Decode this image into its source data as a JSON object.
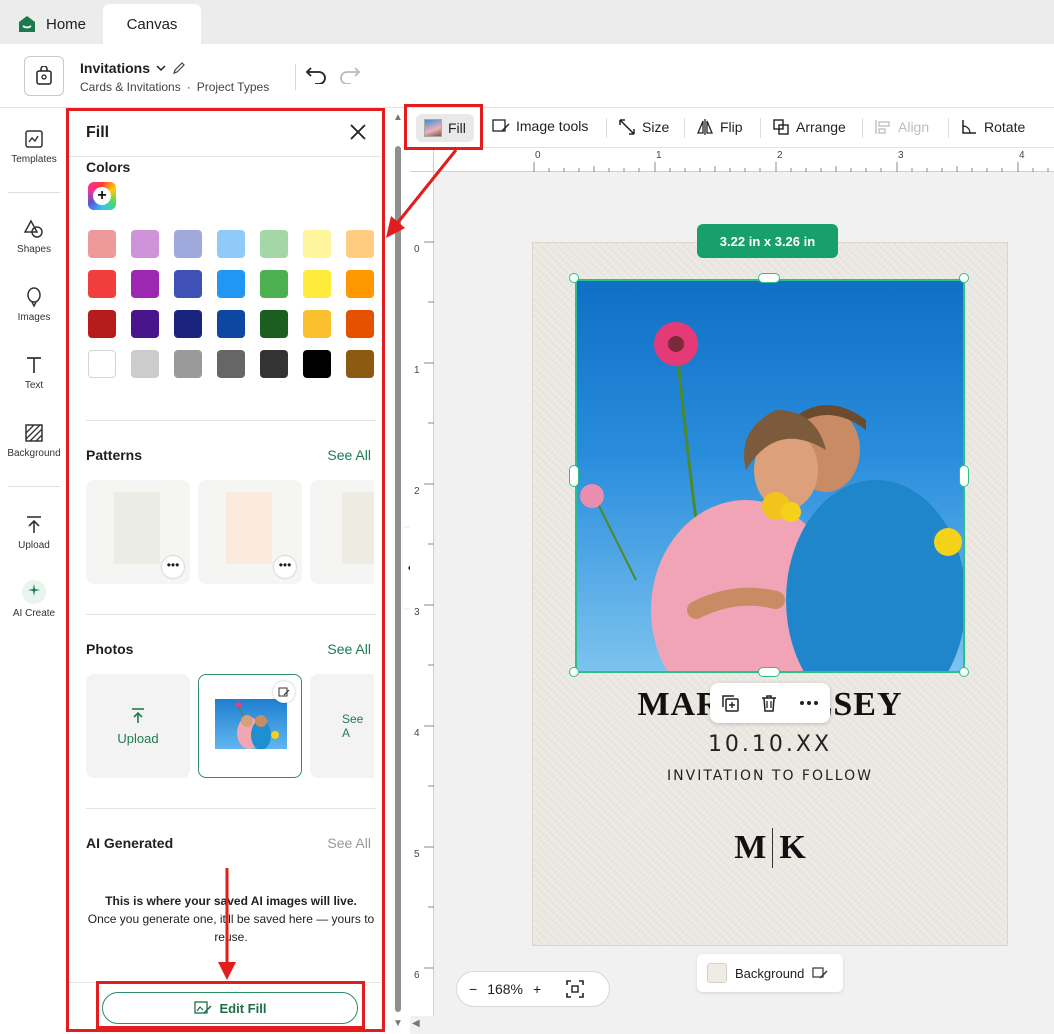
{
  "tabs": {
    "home": "Home",
    "canvas": "Canvas"
  },
  "project": {
    "title": "Invitations",
    "category": "Cards & Invitations",
    "dot": "·",
    "types": "Project Types"
  },
  "rail": {
    "templates": "Templates",
    "shapes": "Shapes",
    "images": "Images",
    "text": "Text",
    "background": "Background",
    "upload": "Upload",
    "ai_create": "AI Create"
  },
  "panel": {
    "title": "Fill",
    "colors": "Colors",
    "patterns": "Patterns",
    "photos": "Photos",
    "ai_generated": "AI Generated",
    "see_all": "See All",
    "upload": "Upload",
    "see_all_partial": "See A",
    "ai_msg_title": "This is where your saved AI images will live.",
    "ai_msg_body": "Once you generate one, it'll be saved here — yours to reuse.",
    "edit_fill": "Edit Fill"
  },
  "swatches": [
    [
      "#ef9a9a",
      "#ce93d8",
      "#9fa8da",
      "#90caf9",
      "#a5d6a7",
      "#fff59d",
      "#ffcc80"
    ],
    [
      "#f23d3d",
      "#9c27b0",
      "#3f51b5",
      "#2196f3",
      "#4caf50",
      "#ffeb3b",
      "#ff9800"
    ],
    [
      "#b71c1c",
      "#4a148c",
      "#1a237e",
      "#0d47a1",
      "#1b5e20",
      "#fbc02d",
      "#e65100"
    ],
    [
      "#ffffff",
      "#cccccc",
      "#999999",
      "#666666",
      "#333333",
      "#000000",
      "#8d5a12"
    ]
  ],
  "toolbar": {
    "fill": "Fill",
    "image_tools": "Image tools",
    "size": "Size",
    "flip": "Flip",
    "arrange": "Arrange",
    "align": "Align",
    "rotate": "Rotate"
  },
  "ruler": {
    "top": [
      "0",
      "1",
      "2",
      "3",
      "4"
    ],
    "left": [
      "0",
      "1",
      "2",
      "3",
      "4",
      "5",
      "6"
    ]
  },
  "card": {
    "size_badge": "3.22  in x 3.26  in",
    "names": "MARK  KELSEY",
    "date": "10.10.XX",
    "follow": "INVITATION TO FOLLOW",
    "mono_left": "M",
    "mono_right": "K"
  },
  "background_btn": "Background",
  "zoom": {
    "minus": "−",
    "level": "168%",
    "plus": "+"
  },
  "colors": {
    "accent": "#1f7a52",
    "annotation": "#e11d1d",
    "selection": "#2cc089"
  }
}
